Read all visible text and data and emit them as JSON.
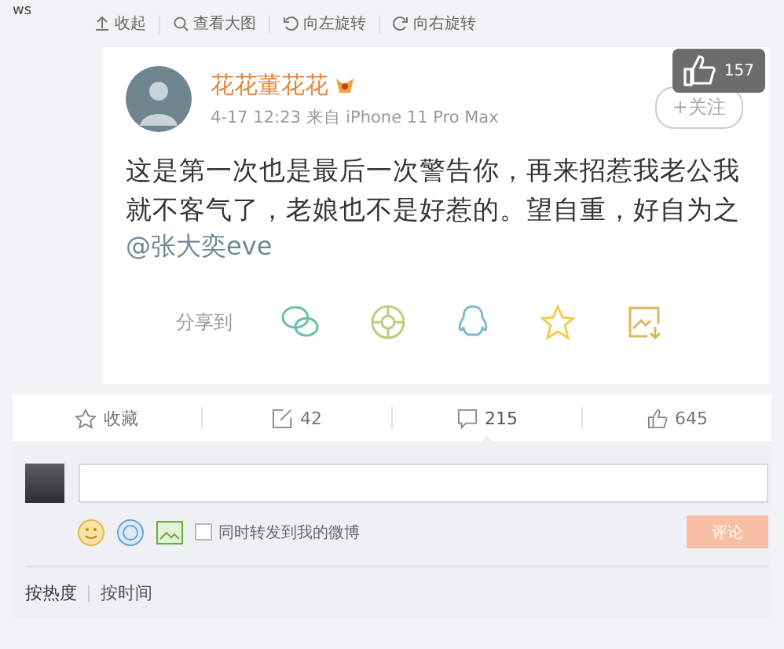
{
  "corner_text": "ws",
  "image_toolbar": [
    {
      "kind": "collapse",
      "label": "收起"
    },
    {
      "kind": "zoom",
      "label": "查看大图"
    },
    {
      "kind": "rotate_left",
      "label": "向左旋转"
    },
    {
      "kind": "rotate_right",
      "label": "向右旋转"
    }
  ],
  "post_screenshot": {
    "author": "花花董花花",
    "meta": "4-17 12:23  来自 iPhone 11 Pro Max",
    "follow": "+关注",
    "like_overlay": "157",
    "text": "这是第一次也是最后一次警告你，再来招惹我老公我就不客气了，老娘也不是好惹的。望自重，好自为之",
    "mention": "@张大奕eve",
    "share_label": "分享到",
    "share_targets": [
      {
        "kind": "wechat",
        "color": "#6cc0a8"
      },
      {
        "kind": "moments",
        "color": "#b9cf7a"
      },
      {
        "kind": "qq",
        "color": "#7cb8d6"
      },
      {
        "kind": "qzone",
        "color": "#f2cd4e"
      },
      {
        "kind": "save",
        "color": "#d8b860"
      }
    ]
  },
  "actions": [
    {
      "kind": "favorite",
      "label": "收藏",
      "selected": false
    },
    {
      "kind": "repost",
      "label": "42",
      "selected": false
    },
    {
      "kind": "comment",
      "label": "215",
      "selected": true
    },
    {
      "kind": "like",
      "label": "645",
      "selected": false
    }
  ],
  "comment_box": {
    "also_repost": {
      "label": "同时转发到我的微博",
      "checked": false
    },
    "submit": "评论",
    "disabled": true
  },
  "sort_tabs": [
    {
      "label": "按热度",
      "selected": true
    },
    {
      "label": "按时间",
      "selected": false
    }
  ]
}
